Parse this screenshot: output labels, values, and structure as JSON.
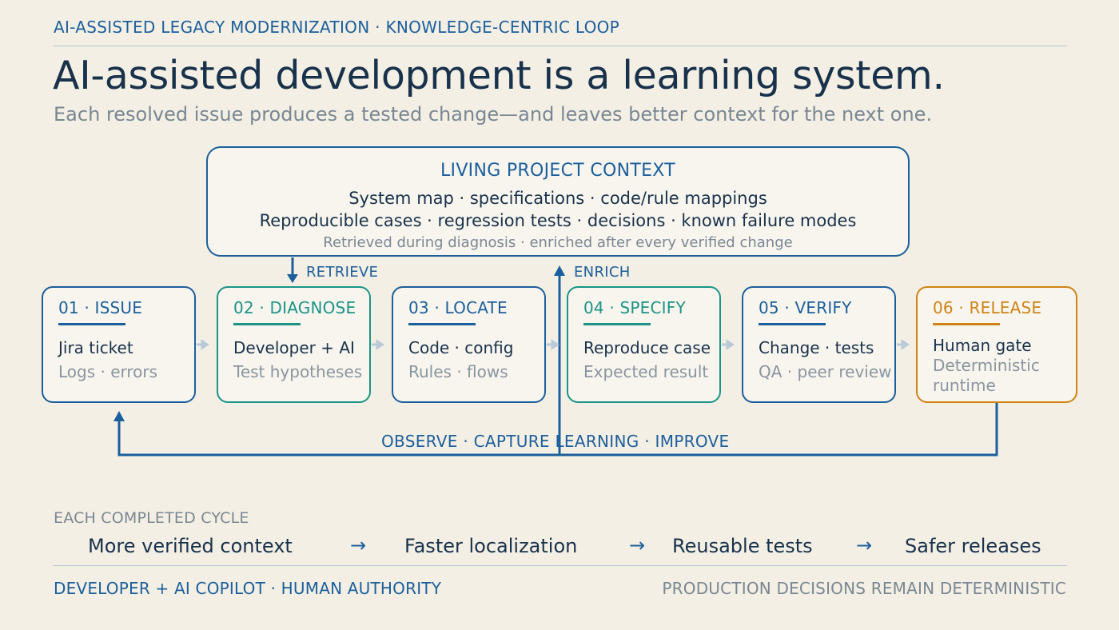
{
  "header": {
    "kicker": "AI-ASSISTED LEGACY MODERNIZATION · KNOWLEDGE-CENTRIC LOOP",
    "title": "AI-assisted development is a learning system.",
    "subtitle": "Each resolved issue produces a tested change—and leaves better context for the next one."
  },
  "context": {
    "title": "LIVING PROJECT CONTEXT",
    "line1": "System map · specifications · code/rule mappings",
    "line2": "Reproducible cases · regression tests · decisions · known failure modes",
    "line3": "Retrieved during diagnosis · enriched after every verified change"
  },
  "flows": {
    "retrieve": "RETRIEVE",
    "enrich": "ENRICH",
    "loop": "OBSERVE · CAPTURE LEARNING · IMPROVE"
  },
  "steps": [
    {
      "num": "01 · ISSUE",
      "line1": "Jira ticket",
      "line2": "Logs · errors",
      "accent": "#1b5f9c"
    },
    {
      "num": "02 · DIAGNOSE",
      "line1": "Developer + AI",
      "line2": "Test hypotheses",
      "accent": "#1a9487"
    },
    {
      "num": "03 · LOCATE",
      "line1": "Code · config",
      "line2": "Rules · flows",
      "accent": "#1b5f9c"
    },
    {
      "num": "04 · SPECIFY",
      "line1": "Reproduce case",
      "line2": "Expected result",
      "accent": "#1a9487"
    },
    {
      "num": "05 · VERIFY",
      "line1": "Change · tests",
      "line2": "QA · peer review",
      "accent": "#1b5f9c"
    },
    {
      "num": "06 · RELEASE",
      "line1": "Human gate",
      "line2": "Deterministic runtime",
      "accent": "#cf8415"
    }
  ],
  "cycle": {
    "heading": "EACH COMPLETED CYCLE",
    "items": [
      "More verified context",
      "Faster localization",
      "Reusable tests",
      "Safer releases"
    ],
    "arrow": "→"
  },
  "footer": {
    "left": "DEVELOPER + AI COPILOT · HUMAN AUTHORITY",
    "right": "PRODUCTION DECISIONS REMAIN DETERMINISTIC"
  },
  "colors": {
    "background": "#f4efe4",
    "primary": "#1b5f9c",
    "teal": "#1a9487",
    "orange": "#cf8415",
    "ink": "#18324b",
    "muted": "#7a8793"
  }
}
